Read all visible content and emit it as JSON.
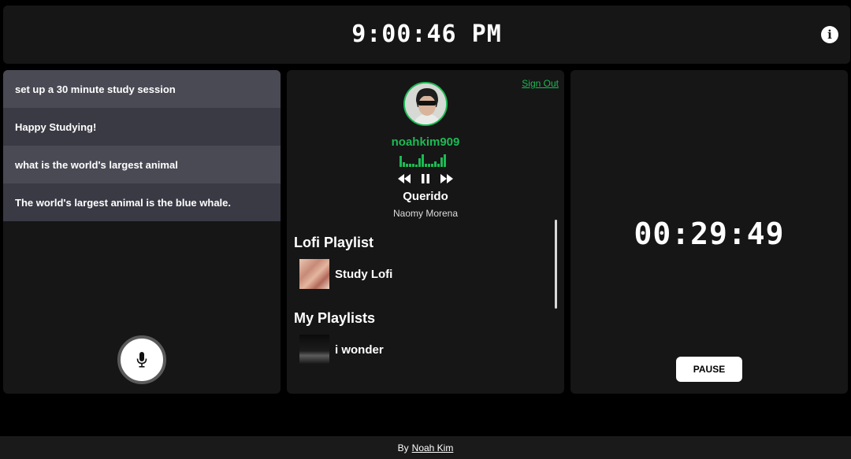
{
  "header": {
    "clock": "9:00:46 PM",
    "info_icon": "info-icon"
  },
  "chat": {
    "messages": [
      {
        "role": "user",
        "text": "set up a 30 minute study session"
      },
      {
        "role": "assistant",
        "text": "Happy Studying!"
      },
      {
        "role": "user",
        "text": "what is the world's largest animal"
      },
      {
        "role": "assistant",
        "text": "The world's largest animal is the blue whale."
      }
    ],
    "mic_icon": "microphone-icon"
  },
  "music": {
    "sign_out": "Sign Out",
    "username": "noahkim909",
    "now_playing": {
      "track": "Querido",
      "artist": "Naomy Morena"
    },
    "controls": [
      "rewind-icon",
      "pause-icon",
      "fast-forward-icon"
    ],
    "lofi_section": {
      "title": "Lofi Playlist",
      "playlists": [
        {
          "name": "Study Lofi"
        }
      ]
    },
    "my_section": {
      "title": "My Playlists",
      "playlists": [
        {
          "name": "i wonder"
        }
      ]
    },
    "accent_color": "#1db954"
  },
  "timer": {
    "countdown": "00:29:49",
    "pause_label": "PAUSE"
  },
  "footer": {
    "prefix": "By",
    "author": "Noah Kim"
  }
}
